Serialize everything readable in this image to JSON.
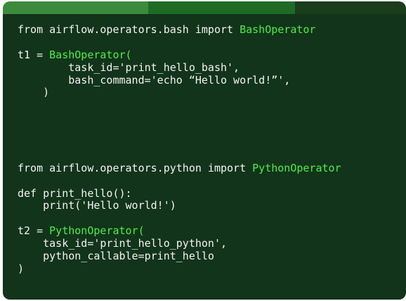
{
  "code_editor": {
    "lines": [
      {
        "text": "from airflow.operators.bash import ",
        "highlight": "BashOperator",
        "rest": ""
      },
      {
        "text": "",
        "highlight": "",
        "rest": ""
      },
      {
        "text": "t1 = ",
        "highlight": "BashOperator(",
        "rest": ""
      },
      {
        "text": "        task_id='print_hello_bash',",
        "highlight": "",
        "rest": ""
      },
      {
        "text": "        bash_command='echo “Hello world!”',",
        "highlight": "",
        "rest": ""
      },
      {
        "text": "    )",
        "highlight": "",
        "rest": ""
      },
      {
        "text": "",
        "highlight": "",
        "rest": ""
      },
      {
        "text": "",
        "highlight": "",
        "rest": ""
      },
      {
        "text": "",
        "highlight": "",
        "rest": ""
      },
      {
        "text": "",
        "highlight": "",
        "rest": ""
      },
      {
        "text": "",
        "highlight": "",
        "rest": ""
      },
      {
        "text": "from airflow.operators.python import ",
        "highlight": "PythonOperator",
        "rest": ""
      },
      {
        "text": "",
        "highlight": "",
        "rest": ""
      },
      {
        "text": "def print_hello():",
        "highlight": "",
        "rest": ""
      },
      {
        "text": "    print('Hello world!')",
        "highlight": "",
        "rest": ""
      },
      {
        "text": "",
        "highlight": "",
        "rest": ""
      },
      {
        "text": "t2 = ",
        "highlight": "PythonOperator(",
        "rest": ""
      },
      {
        "text": "    task_id='print_hello_python',",
        "highlight": "",
        "rest": ""
      },
      {
        "text": "    python_callable=print_hello",
        "highlight": "",
        "rest": ""
      },
      {
        "text": ")",
        "highlight": "",
        "rest": ""
      }
    ]
  },
  "colors": {
    "panel_background": "#12341a",
    "code_text": "#f3f3f3",
    "highlight": "#4ded4a",
    "tab_active": "#3c8b3d",
    "tab_inactive": "#1f6b26"
  }
}
